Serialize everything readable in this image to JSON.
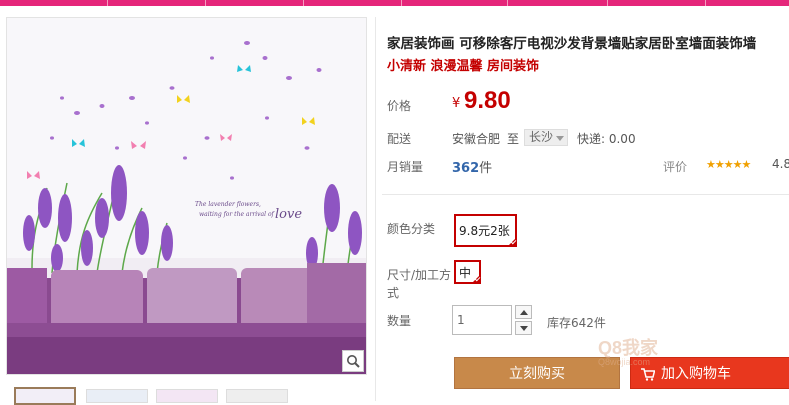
{
  "product": {
    "title": "家居装饰画 可移除客厅电视沙发背景墙贴家居卧室墙面装饰墙",
    "subtitle": "小清新 浪漫温馨 房间装饰",
    "image_caption_line1": "The lavender flowers,",
    "image_caption_line2": "waiting for the arrival of",
    "image_caption_love": "love"
  },
  "price": {
    "label": "价格",
    "currency": "¥",
    "value": "9.80"
  },
  "shipping": {
    "label": "配送",
    "origin": "安徽合肥",
    "to": "至",
    "destination": "长沙",
    "express": "快递: 0.00"
  },
  "sales": {
    "label": "月销量",
    "count": "362",
    "unit": "件",
    "rating_label": "评价",
    "stars": "★★★★★",
    "rating": "4.8"
  },
  "options": {
    "color_label": "颜色分类",
    "color_value": "9.8元2张",
    "size_label_line1": "尺寸/加工方",
    "size_label_line2": "式",
    "size_value": "中"
  },
  "quantity": {
    "label": "数量",
    "value": "1",
    "stock": "库存642件"
  },
  "actions": {
    "buy": "立刻购买",
    "add_to_cart": "加入购物车"
  },
  "watermark": {
    "line1": "Q8我家",
    "line2": "Q8wojia.com"
  },
  "colors": {
    "accent": "#c40000",
    "nav": "#e5267a",
    "buy_button": "#c8894a",
    "cart_button": "#e8371e"
  }
}
